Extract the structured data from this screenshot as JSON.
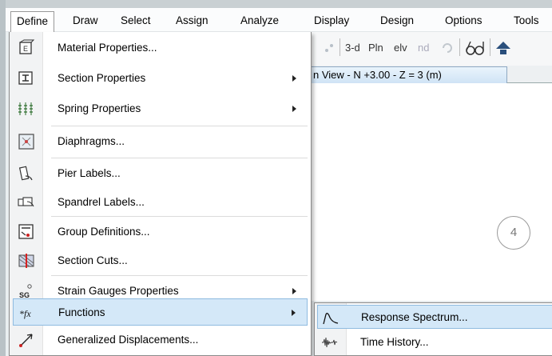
{
  "menubar": {
    "items": [
      {
        "label": "Define"
      },
      {
        "label": "Draw"
      },
      {
        "label": "Select"
      },
      {
        "label": "Assign"
      },
      {
        "label": "Analyze"
      },
      {
        "label": "Display"
      },
      {
        "label": "Design"
      },
      {
        "label": "Options"
      },
      {
        "label": "Tools"
      }
    ]
  },
  "toolbar": {
    "view_3d": "3-d",
    "plan": "Pln",
    "elev": "elv",
    "nd": "nd"
  },
  "view_tab": {
    "label": "n View - N +3.00 - Z = 3 (m)"
  },
  "canvas": {
    "grid_bubble": "4"
  },
  "define_menu": {
    "items": [
      {
        "label": "Material Properties...",
        "icon": "material-properties-icon"
      },
      {
        "label": "Section Properties",
        "icon": "section-properties-icon"
      },
      {
        "label": "Spring Properties",
        "icon": "spring-properties-icon"
      },
      {
        "label": "Diaphragms...",
        "icon": "diaphragm-icon"
      },
      {
        "label": "Pier Labels...",
        "icon": "pier-label-icon"
      },
      {
        "label": "Spandrel Labels...",
        "icon": "spandrel-label-icon"
      },
      {
        "label": "Group Definitions...",
        "icon": "group-definition-icon"
      },
      {
        "label": "Section Cuts...",
        "icon": "section-cut-icon"
      },
      {
        "label": "Strain Gauges Properties",
        "icon": "strain-gauge-icon",
        "icon_text": "SG"
      },
      {
        "label": "Functions",
        "icon": "functions-icon",
        "icon_text": "*fx"
      },
      {
        "label": "Generalized Displacements...",
        "icon": "generalized-displacement-icon"
      }
    ]
  },
  "functions_submenu": {
    "items": [
      {
        "label": "Response Spectrum...",
        "icon": "response-spectrum-icon"
      },
      {
        "label": "Time History...",
        "icon": "time-history-icon"
      }
    ]
  },
  "colors": {
    "highlight": "#d4e8f8",
    "highlight_border": "#8fbbe0",
    "tab_gradient_bottom": "#cfe3f5"
  }
}
